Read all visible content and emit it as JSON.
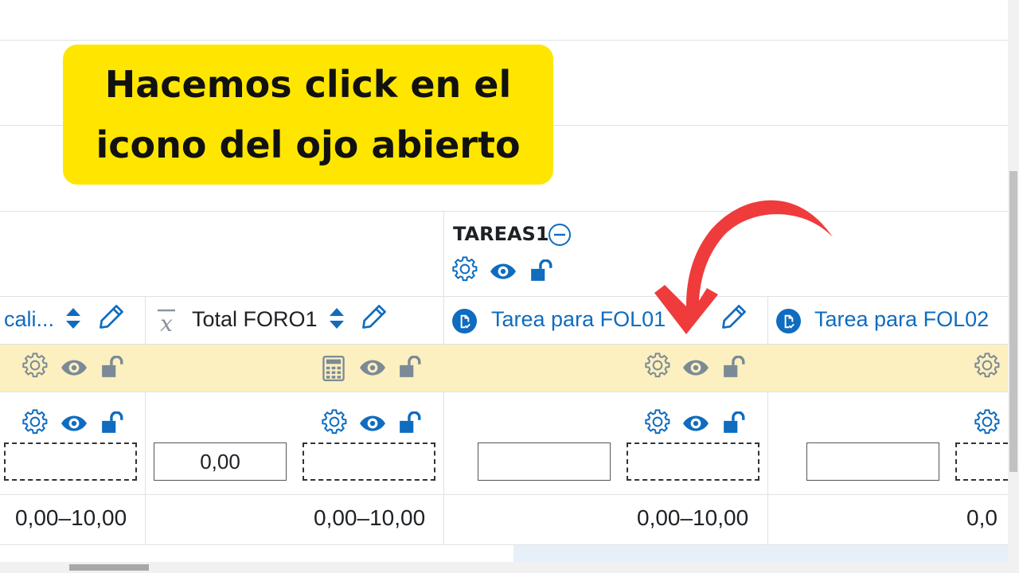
{
  "callout": {
    "line1": "Hacemos click en el",
    "line2": "icono del ojo abierto"
  },
  "category": {
    "title": "TAREAS1"
  },
  "columns": {
    "col1_label": "cali...",
    "col2_label": "Total FORO1",
    "col3_label": "Tarea para FOL01",
    "col4_label": "Tarea para FOL02"
  },
  "inputs": {
    "total_foro1_value": "0,00"
  },
  "ranges": {
    "col1": "0,00–10,00",
    "col2": "0,00–10,00",
    "col3": "0,00–10,00",
    "col4": "0,0"
  },
  "colors": {
    "accent": "#0f6cbf",
    "callout": "#ffe600",
    "highlight_row": "#fcefc0",
    "arrow": "#ef3b3b"
  },
  "icons": [
    "cog-icon",
    "eye-icon",
    "unlock-icon",
    "sort-icon",
    "pencil-icon",
    "calculator-icon",
    "assign-icon",
    "collapse-icon",
    "mean-icon"
  ]
}
